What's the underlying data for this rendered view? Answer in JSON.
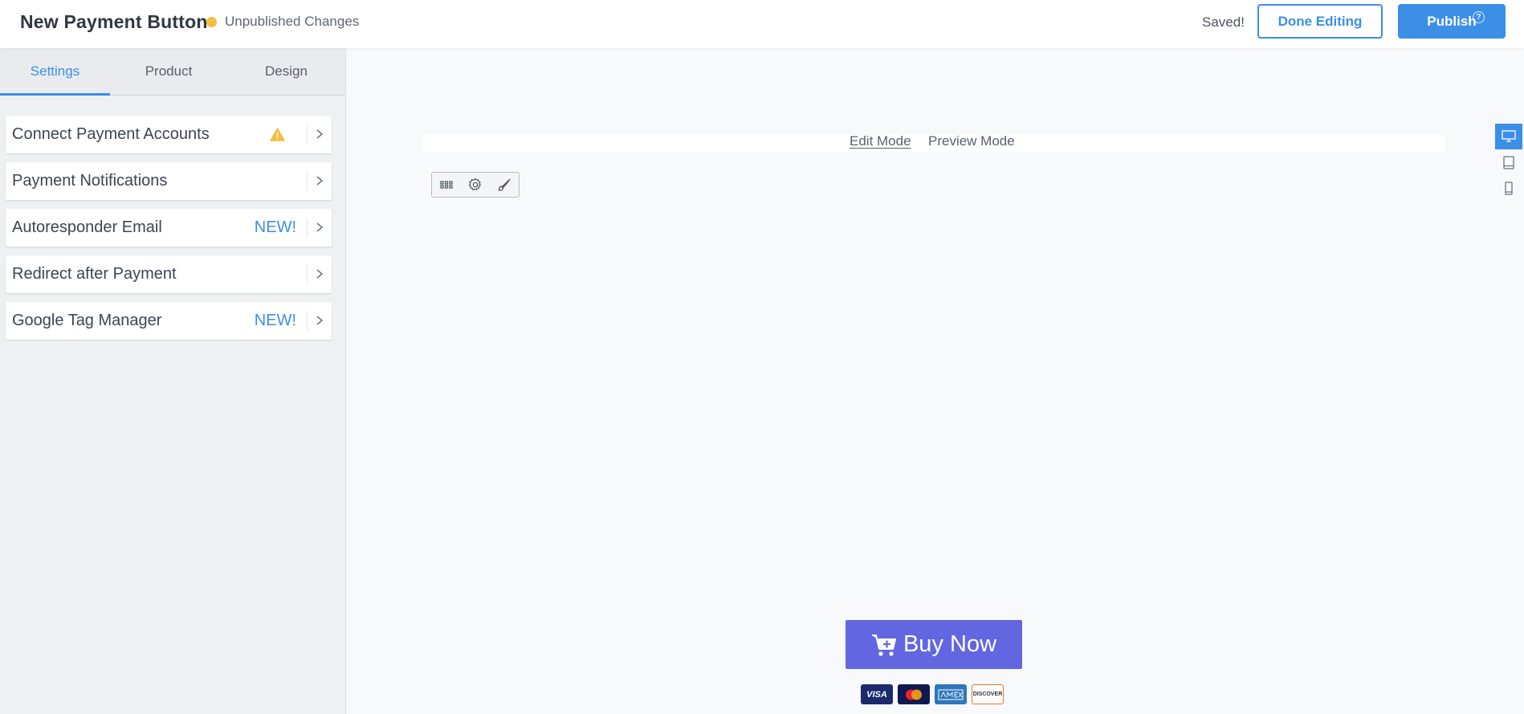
{
  "header": {
    "title": "New Payment Button",
    "status": "Unpublished Changes",
    "saved": "Saved!",
    "done_label": "Done Editing",
    "publish_label": "Publish",
    "publish_help": "?"
  },
  "sidebar": {
    "tabs": [
      {
        "label": "Settings",
        "active": true
      },
      {
        "label": "Product",
        "active": false
      },
      {
        "label": "Design",
        "active": false
      }
    ],
    "items": [
      {
        "label": "Connect Payment Accounts",
        "badge": "",
        "warning": true
      },
      {
        "label": "Payment Notifications",
        "badge": "",
        "warning": false
      },
      {
        "label": "Autoresponder Email",
        "badge": "NEW!",
        "warning": false
      },
      {
        "label": "Redirect after Payment",
        "badge": "",
        "warning": false
      },
      {
        "label": "Google Tag Manager",
        "badge": "NEW!",
        "warning": false
      }
    ]
  },
  "canvas": {
    "edit_mode": "Edit Mode",
    "preview_mode": "Preview Mode",
    "tools": [
      "grid-icon",
      "gear-icon",
      "brush-icon"
    ],
    "devices": [
      "desktop-icon",
      "tablet-icon",
      "mobile-icon"
    ],
    "buy_label": "Buy Now",
    "cards": [
      "VISA",
      "MasterCard",
      "AMEX",
      "DISCOVER"
    ]
  },
  "colors": {
    "accent": "#3b8fe6",
    "buy_button": "#6366e1",
    "status_dot": "#f5bd41",
    "warning": "#f5bd41"
  }
}
